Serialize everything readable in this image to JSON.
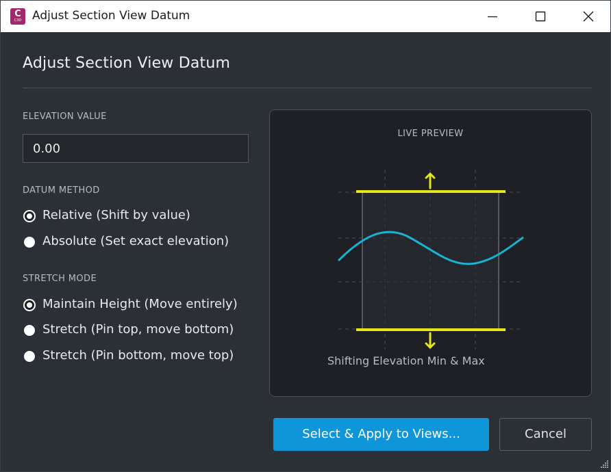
{
  "window": {
    "title": "Adjust Section View Datum",
    "app_icon_letter": "C",
    "app_icon_sub": "C3D",
    "app_icon_color": "#a3276b"
  },
  "dialog": {
    "heading": "Adjust Section View Datum",
    "elevation": {
      "label": "ELEVATION VALUE",
      "value": "0.00"
    },
    "datum_method": {
      "label": "DATUM METHOD",
      "options": [
        {
          "label": "Relative (Shift by value)",
          "checked": true
        },
        {
          "label": "Absolute (Set exact elevation)",
          "checked": false
        }
      ]
    },
    "stretch_mode": {
      "label": "STRETCH MODE",
      "options": [
        {
          "label": "Maintain Height (Move entirely)",
          "checked": true
        },
        {
          "label": "Stretch (Pin top, move bottom)",
          "checked": false
        },
        {
          "label": "Stretch (Pin bottom, move top)",
          "checked": false
        }
      ]
    },
    "preview": {
      "label": "LIVE PREVIEW",
      "caption": "Shifting Elevation Min & Max",
      "datum_color": "#e6e619",
      "profile_color": "#1ab4d0"
    },
    "buttons": {
      "primary": "Select & Apply to Views...",
      "cancel": "Cancel"
    }
  },
  "colors": {
    "accent": "#0f96d8",
    "background": "#2b2f36"
  }
}
